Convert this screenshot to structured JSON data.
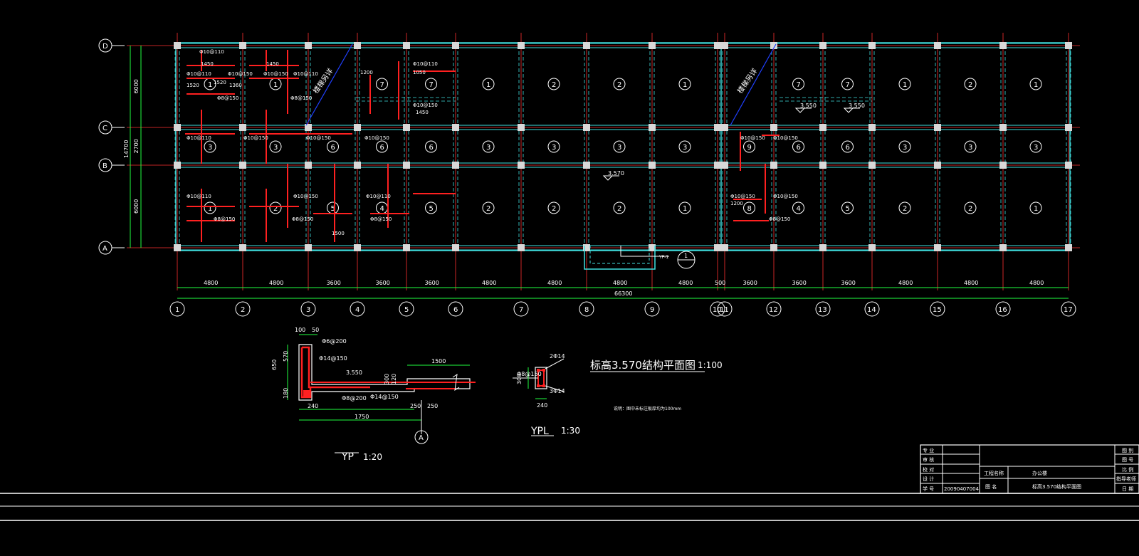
{
  "plan": {
    "row_axes": [
      "D",
      "C",
      "B",
      "A"
    ],
    "col_axes": [
      "1",
      "2",
      "3",
      "4",
      "5",
      "6",
      "7",
      "8",
      "9",
      "10",
      "11",
      "12",
      "13",
      "14",
      "15",
      "16",
      "17"
    ],
    "left_dims": [
      "6000",
      "2700",
      "6000"
    ],
    "left_total": "14700",
    "bottom_dims": [
      "4800",
      "4800",
      "3600",
      "3600",
      "3600",
      "4800",
      "4800",
      "4800",
      "4800",
      "500",
      "3600",
      "3600",
      "3600",
      "4800",
      "4800",
      "4800"
    ],
    "bottom_total": "66300",
    "stair_label": "楼梯另详",
    "level_marks": [
      "3.550",
      "3.550",
      "3.570"
    ],
    "section_callout_text": "YP-1",
    "section_callout_num": "1"
  },
  "slabs_top": [
    "1",
    "1",
    "7",
    "7",
    "1",
    "2",
    "2",
    "1",
    "7",
    "7",
    "1",
    "2",
    "1"
  ],
  "slabs_mid": [
    "3",
    "3",
    "6",
    "6",
    "6",
    "3",
    "3",
    "3",
    "3",
    "9",
    "6",
    "6",
    "3",
    "3",
    "3"
  ],
  "slabs_bot": [
    "1",
    "2",
    "5",
    "4",
    "5",
    "2",
    "2",
    "2",
    "1",
    "8",
    "4",
    "5",
    "2",
    "2",
    "1"
  ],
  "rebar_notes": [
    "Φ10@110",
    "Φ8@150",
    "Φ10@150",
    "1360",
    "1520",
    "1050",
    "760",
    "1200",
    "1450",
    "720",
    "850",
    "1500",
    "3.550"
  ],
  "details": {
    "yp_title": "YP",
    "yp_scale": "1:20",
    "yp_dims": [
      "100",
      "50",
      "650",
      "570",
      "180",
      "240",
      "1750",
      "1500",
      "250",
      "250",
      "300",
      "120"
    ],
    "yp_rebar": [
      "Φ6@200",
      "Φ14@150",
      "Φ8@200",
      "Φ14@150",
      "3.550"
    ],
    "yp_axis": "A",
    "ypl_title": "YPL",
    "ypl_scale": "1:30",
    "ypl_rebar": [
      "2Φ14",
      "Φ8@150",
      "3Φ14"
    ],
    "ypl_dims": [
      "300",
      "240"
    ],
    "main_title": "标高3.570结构平面图",
    "main_scale": "1:100",
    "note": "说明：图中未标注板厚均为100mm"
  },
  "title_block": {
    "left_labels": [
      "专 业",
      "审 核",
      "校 对",
      "设 计",
      "学 号"
    ],
    "student_no": "20090407004",
    "project_label": "工程名称",
    "project_value": "办公楼",
    "drawing_label": "图 名",
    "drawing_value": "标高3.570结构平面图",
    "right_labels": [
      "图 别",
      "图 号",
      "比 例",
      "指导老师",
      "日 期"
    ]
  },
  "colors": {
    "background": "#000000",
    "grid_axis": "#ff3030",
    "beam": "#40e0e0",
    "rebar": "#ff2020",
    "dimension": "#20ff40",
    "text": "#ffffff",
    "stair": "#2040ff"
  }
}
